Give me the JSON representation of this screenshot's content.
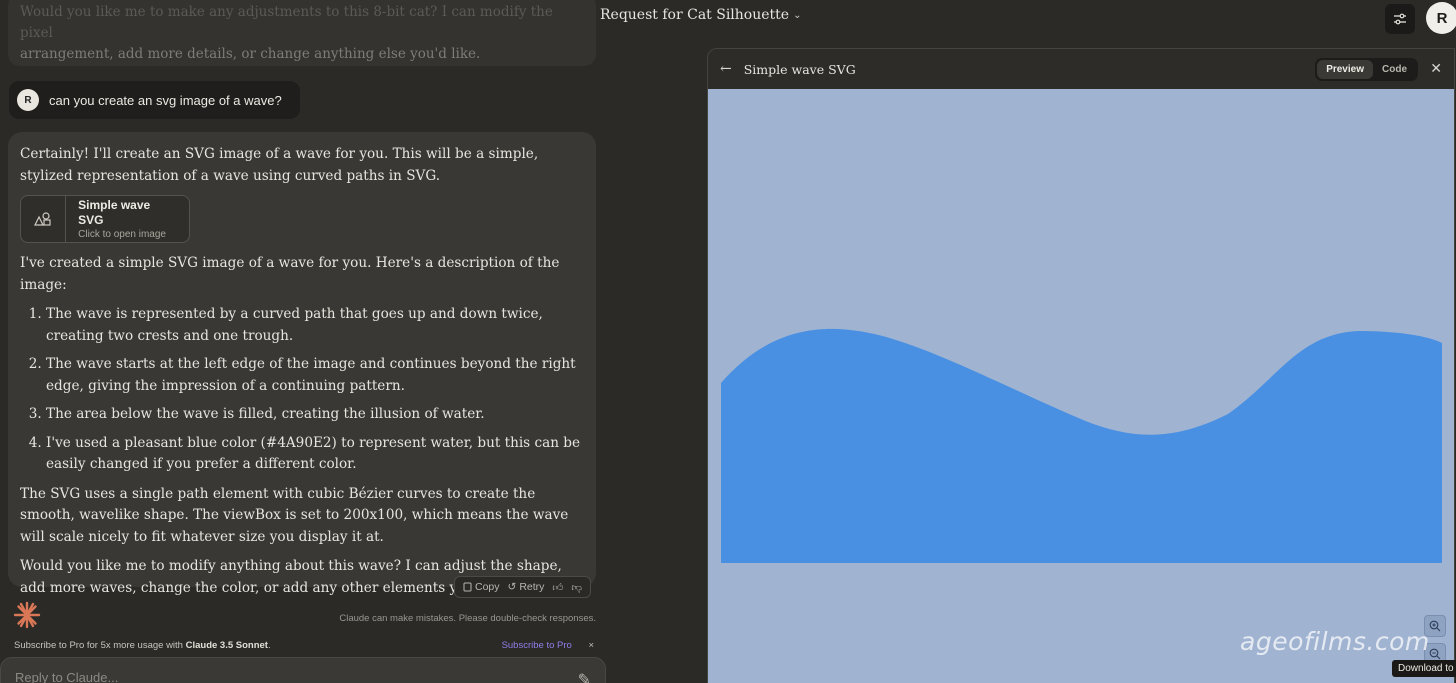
{
  "header": {
    "chat_title": "Request for Cat Silhouette",
    "user_initial": "R"
  },
  "previous_message": {
    "line1": "Would you like me to make any adjustments to this 8-bit cat? I can modify the pixel",
    "line2": "arrangement, add more details, or change anything else you'd like."
  },
  "user_message": {
    "initial": "R",
    "text": "can you create an svg image of a wave?"
  },
  "assistant": {
    "intro": "Certainly! I'll create an SVG image of a wave for you. This will be a simple, stylized representation of a wave using curved paths in SVG.",
    "artifact": {
      "title": "Simple wave SVG",
      "subtitle": "Click to open image",
      "icon": "shapes-icon"
    },
    "description_intro": "I've created a simple SVG image of a wave for you. Here's a description of the image:",
    "list": [
      "The wave is represented by a curved path that goes up and down twice, creating two crests and one trough.",
      "The wave starts at the left edge of the image and continues beyond the right edge, giving the impression of a continuing pattern.",
      "The area below the wave is filled, creating the illusion of water.",
      "I've used a pleasant blue color (#4A90E2) to represent water, but this can be easily changed if you prefer a different color."
    ],
    "paragraph_svg": "The SVG uses a single path element with cubic Bézier curves to create the smooth, wavelike shape. The viewBox is set to 200x100, which means the wave will scale nicely to fit whatever size you display it at.",
    "closing": "Would you like me to modify anything about this wave? I can adjust the shape, add more waves, change the color, or add any other elements you might want."
  },
  "actions": {
    "copy": "Copy",
    "retry": "Retry"
  },
  "disclaimer": "Claude can make mistakes. Please double-check responses.",
  "subscribe": {
    "text_prefix": "Subscribe to Pro for 5x more usage with ",
    "model": "Claude 3.5 Sonnet",
    "text_suffix": ".",
    "link": "Subscribe to Pro",
    "close": "×"
  },
  "reply": {
    "placeholder": "Reply to Claude..."
  },
  "panel": {
    "title": "Simple wave SVG",
    "tab_preview": "Preview",
    "tab_code": "Code",
    "close": "✕"
  },
  "wave": {
    "fill_color": "#4A90E2",
    "background_color": "#A0B4D2"
  },
  "watermark": "ageofilms.com",
  "tooltip": "Download to f"
}
